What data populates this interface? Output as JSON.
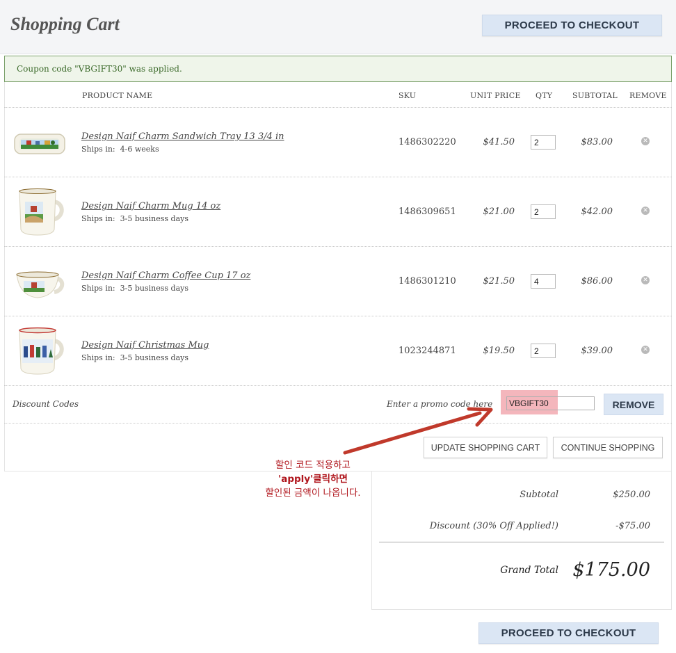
{
  "header": {
    "title": "Shopping Cart",
    "checkout_label": "PROCEED TO CHECKOUT"
  },
  "notice": "Coupon code \"VBGIFT30\" was applied.",
  "table": {
    "columns": [
      "PRODUCT NAME",
      "SKU",
      "UNIT PRICE",
      "QTY",
      "SUBTOTAL",
      "REMOVE"
    ]
  },
  "items": [
    {
      "name": "Design Naif Charm Sandwich Tray 13 3/4 in",
      "ships_label": "Ships in:",
      "ships": "4-6 weeks",
      "sku": "1486302220",
      "unit_price": "$41.50",
      "qty": "2",
      "subtotal": "$83.00",
      "remove_icon": "remove-x-icon"
    },
    {
      "name": "Design Naif Charm Mug 14 oz",
      "ships_label": "Ships in:",
      "ships": "3-5 business days",
      "sku": "1486309651",
      "unit_price": "$21.00",
      "qty": "2",
      "subtotal": "$42.00",
      "remove_icon": "remove-x-icon"
    },
    {
      "name": "Design Naif Charm Coffee Cup 17 oz",
      "ships_label": "Ships in:",
      "ships": "3-5 business days",
      "sku": "1486301210",
      "unit_price": "$21.50",
      "qty": "4",
      "subtotal": "$86.00",
      "remove_icon": "remove-x-icon"
    },
    {
      "name": "Design Naif Christmas Mug",
      "ships_label": "Ships in:",
      "ships": "3-5 business days",
      "sku": "1023244871",
      "unit_price": "$19.50",
      "qty": "2",
      "subtotal": "$39.00",
      "remove_icon": "remove-x-icon"
    }
  ],
  "discount": {
    "label": "Discount Codes",
    "promo_placeholder": "Enter a promo code here",
    "code_value": "VBGIFT30",
    "remove_label": "REMOVE"
  },
  "actions": {
    "update_label": "UPDATE SHOPPING CART",
    "continue_label": "CONTINUE SHOPPING"
  },
  "annotation": {
    "lines": [
      "할인 코드 적용하고",
      "'apply'클릭하면",
      "할인된 금액이 나옵니다."
    ],
    "color": "#b0161d"
  },
  "totals": {
    "subtotal_label": "Subtotal",
    "subtotal_value": "$250.00",
    "discount_label": "Discount (30% Off Applied!)",
    "discount_value": "-$75.00",
    "grand_total_label": "Grand Total",
    "grand_total_value": "$175.00"
  },
  "footer": {
    "checkout_label": "PROCEED TO CHECKOUT"
  },
  "colors": {
    "button_bg": "#dbe6f4",
    "notice_bg": "#eff5ea",
    "notice_border": "#7aa06a",
    "highlight": "#f4b6bc"
  }
}
